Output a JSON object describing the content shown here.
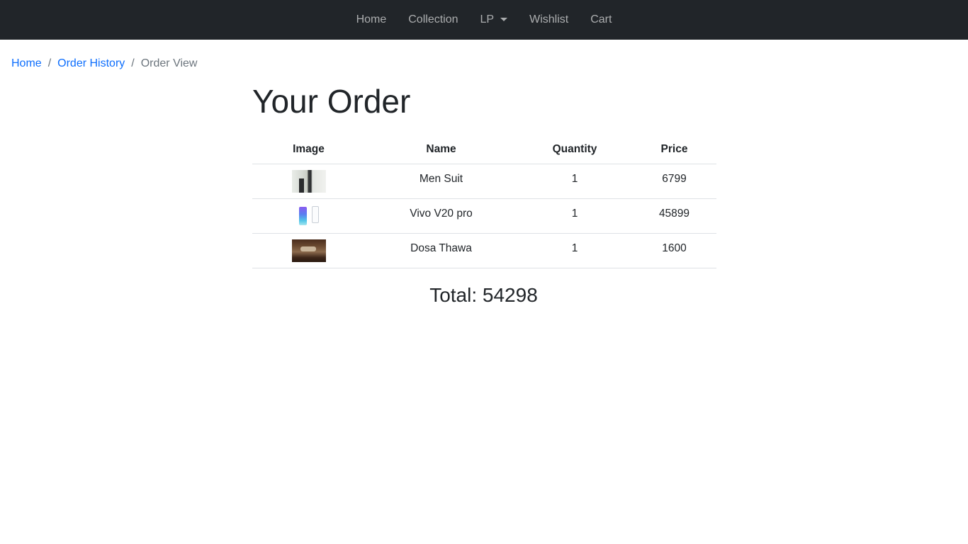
{
  "navbar": {
    "items": [
      {
        "label": "Home"
      },
      {
        "label": "Collection"
      },
      {
        "label": "LP"
      },
      {
        "label": "Wishlist"
      },
      {
        "label": "Cart"
      }
    ]
  },
  "breadcrumb": {
    "items": [
      {
        "label": "Home"
      },
      {
        "label": "Order History"
      },
      {
        "label": "Order View"
      }
    ],
    "separator": "/"
  },
  "page": {
    "title": "Your Order",
    "table": {
      "headers": [
        "Image",
        "Name",
        "Quantity",
        "Price"
      ],
      "rows": [
        {
          "image": "men-suit-thumbnail",
          "name": "Men Suit",
          "quantity": "1",
          "price": "6799"
        },
        {
          "image": "vivo-phone-thumbnail",
          "name": "Vivo V20 pro",
          "quantity": "1",
          "price": "45899"
        },
        {
          "image": "dosa-thawa-thumbnail",
          "name": "Dosa Thawa",
          "quantity": "1",
          "price": "1600"
        }
      ]
    },
    "total_label": "Total: 54298"
  },
  "colors": {
    "navbar_bg": "#212529",
    "link": "#0d6efd",
    "muted": "#6c757d"
  }
}
